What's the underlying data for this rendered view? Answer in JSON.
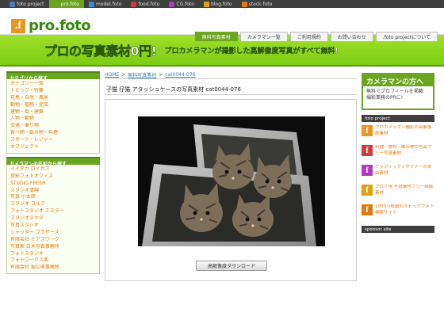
{
  "top_tabs": [
    {
      "label": "foto project",
      "icon": "foto-project-icon",
      "color": "#4a7ac0",
      "active": false
    },
    {
      "label": "pro.foto",
      "icon": "pro-foto-icon",
      "color": "#6aa51f",
      "active": true
    },
    {
      "label": "model.foto",
      "icon": "model-foto-icon",
      "color": "#3a8ad0",
      "active": false
    },
    {
      "label": "food.foto",
      "icon": "food-foto-icon",
      "color": "#d03a3a",
      "active": false
    },
    {
      "label": "CG.foto",
      "icon": "cg-foto-icon",
      "color": "#b03ac0",
      "active": false
    },
    {
      "label": "blog.foto",
      "icon": "blog-foto-icon",
      "color": "#e0a010",
      "active": false
    },
    {
      "label": "stock.foto",
      "icon": "stock-foto-icon",
      "color": "#e07a10",
      "active": false
    }
  ],
  "logo": {
    "mark": ".f",
    "text": "pro.foto"
  },
  "nav": [
    {
      "label": "無料写真素材",
      "active": true
    },
    {
      "label": "カメラマン一覧",
      "active": false
    },
    {
      "label": "ご利用規約",
      "active": false
    },
    {
      "label": "お問い合わせ",
      "active": false
    },
    {
      "label": ".foto projectについて",
      "active": false
    }
  ],
  "banner": {
    "main": "プロの写真素材0円!",
    "sub": "プロカメラマンが撮影した高解像度写真がすべて無料!"
  },
  "sidebar": {
    "category_title": "カテゴリから探す",
    "categories": [
      "カテゴリー一覧",
      "トピック・特集",
      "花鳥・自然・風景",
      "動物・植物・昆虫",
      "建物・街・建築",
      "人物・動物",
      "交通・乗り物",
      "食べ物・飲み物・料理",
      "スポーツ・レジャー",
      "オブジェクト"
    ],
    "photographer_title": "カメラマンの名前から探す",
    "photographers": [
      "イイダカ ロイカズ",
      "提影フォトオフィス",
      "STUDIO FRESH",
      "スタジオ清陽",
      "写真 小太郎",
      "スタジオ コルク",
      "フォトスタジオ エスター",
      "スタジオタケダ",
      "写真スタジオ",
      "シャッター ブラザーズ",
      "有限会社 ミアズワーク",
      "写真家 白木写真事務所",
      "フォトスタジオ",
      "フォトワークス楽",
      "有限会社 堀公典事務所"
    ]
  },
  "breadcrumb": [
    "HOME",
    "無料写真素材",
    "cat0044-076"
  ],
  "photo": {
    "title": "子猫 仔猫 アタッシュケースの写真素材 cat0044-076",
    "download_label": "高解像度ダウンロード"
  },
  "right": {
    "promo_title": "カメラマンの方へ",
    "promo_body": "無料でプロフィールを掲載\n撮影業務のPRに!",
    "section_title": "foto project",
    "projects": [
      {
        "text": "プロカメラマン撮影の高解像度素材",
        "color": "#e8961c"
      },
      {
        "text": "料理・食材・飲み物の写真フリー写真素材",
        "color": "#d03a3a"
      },
      {
        "text": "グラフィックデザイナーの自由素材",
        "color": "#b03ac0"
      },
      {
        "text": "ブログ用 写真素材フリー画像素材",
        "color": "#e0a010"
      },
      {
        "text": "1000万枚超のストックフォト検索サイト",
        "color": "#e07a10"
      }
    ],
    "sponsor_title": "sponsor site"
  }
}
